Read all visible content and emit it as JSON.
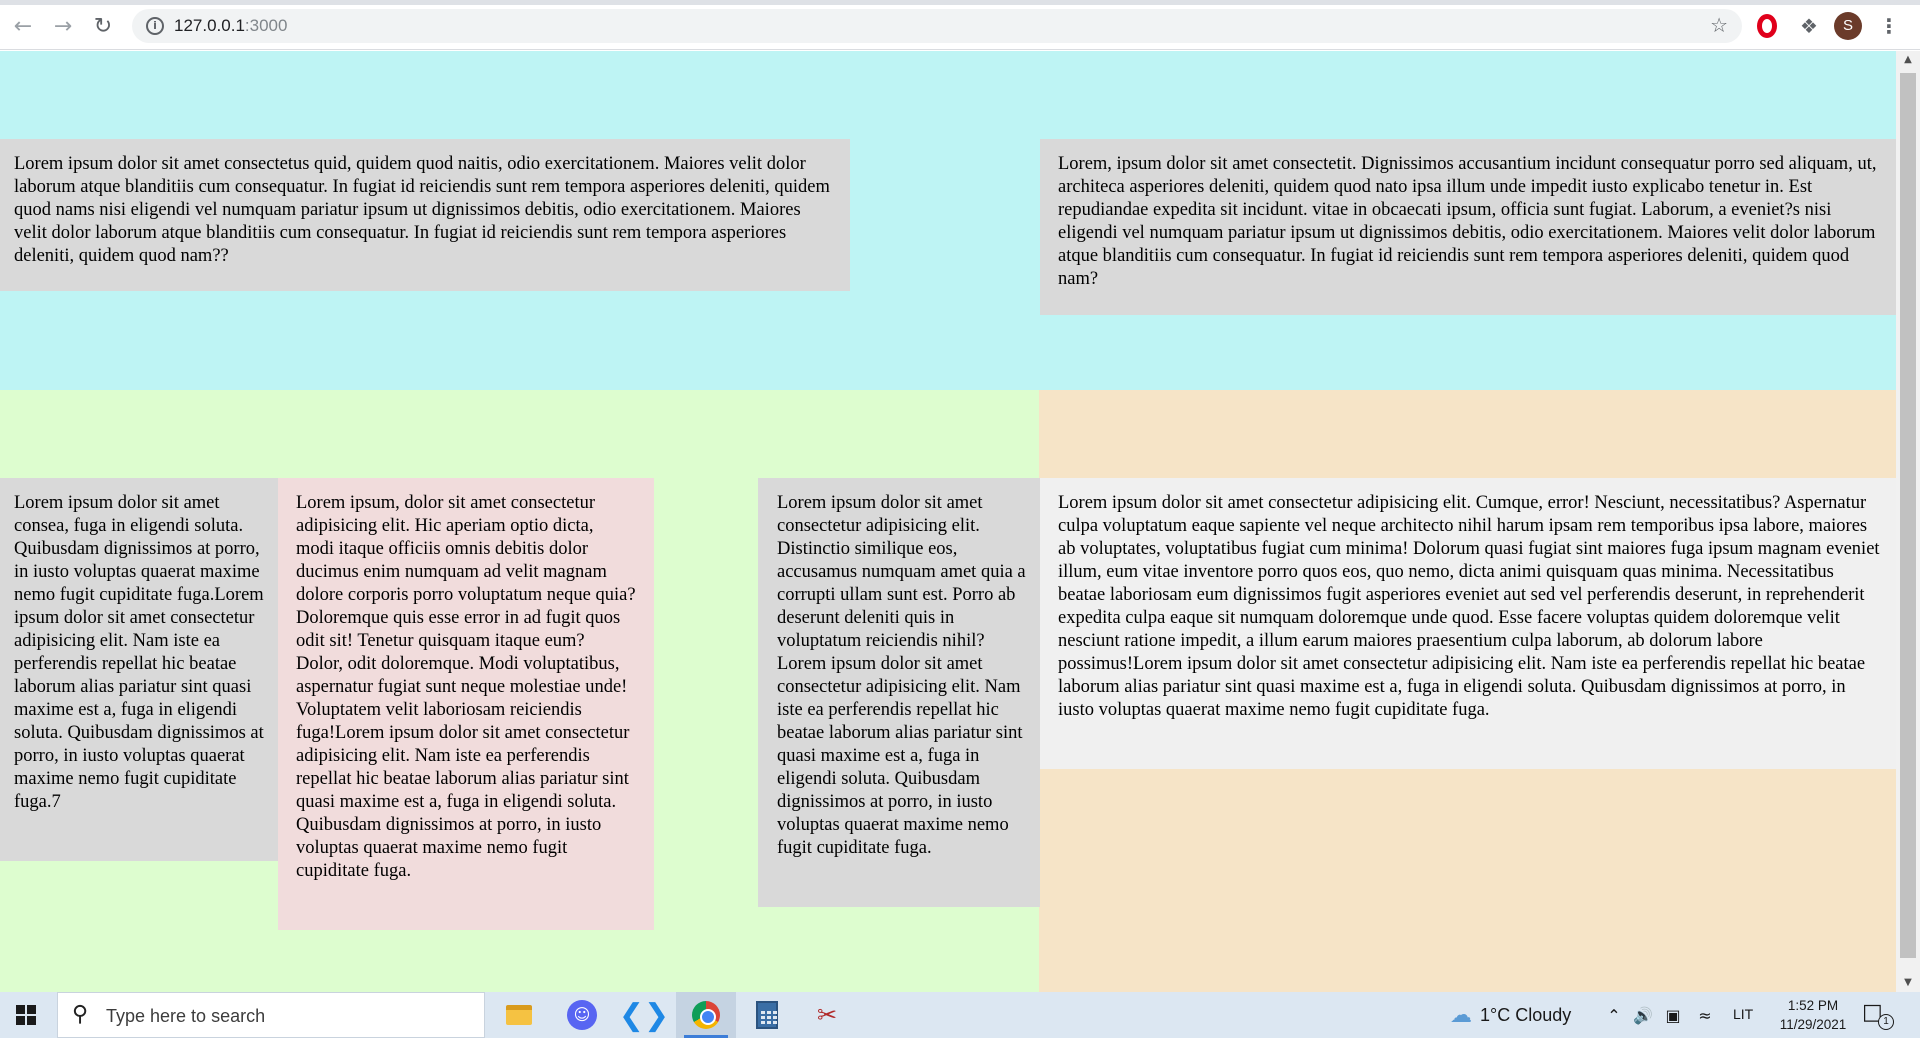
{
  "browser": {
    "url_host": "127.0.0.1",
    "url_port": ":3000",
    "profile_initial": "S",
    "icons": [
      "back-icon",
      "forward-icon",
      "reload-icon",
      "site-info-icon",
      "bookmark-star-icon",
      "opera-adblock-icon",
      "extensions-puzzle-icon",
      "menu-kebab-icon"
    ]
  },
  "colors": {
    "cyan_band": "#bef4f4",
    "green_band": "#ddfdcf",
    "peach_band": "#f6e4c7",
    "gray_box": "#d9d9d9",
    "pink_box": "#f1dcdc",
    "light_box": "#f0f0f0"
  },
  "page": {
    "box_top_left": "Lorem ipsum dolor sit amet consectetus quid, quidem quod naitis, odio exercitationem. Maiores velit dolor laborum atque blanditiis cum consequatur. In fugiat id reiciendis sunt rem tempora asperiores deleniti, quidem quod nams nisi eligendi vel numquam pariatur ipsum ut dignissimos debitis, odio exercitationem. Maiores velit dolor laborum atque blanditiis cum consequatur. In fugiat id reiciendis sunt rem tempora asperiores deleniti, quidem quod nam??",
    "box_top_right": "Lorem, ipsum dolor sit amet consectetit. Dignissimos accusantium incidunt consequatur porro sed aliquam, ut, architeca asperiores deleniti, quidem quod nato ipsa illum unde impedit iusto explicabo tenetur in. Est repudiandae expedita sit incidunt. vitae in obcaecati ipsum, officia sunt fugiat. Laborum, a eveniet?s nisi eligendi vel numquam pariatur ipsum ut dignissimos debitis, odio exercitationem. Maiores velit dolor laborum atque blanditiis cum consequatur. In fugiat id reiciendis sunt rem tempora asperiores deleniti, quidem quod nam?",
    "box_bottom_1": "Lorem ipsum dolor sit amet consea, fuga in eligendi soluta. Quibusdam dignissimos at porro, in iusto voluptas quaerat maxime nemo fugit cupiditate fuga.Lorem ipsum dolor sit amet consectetur adipisicing elit. Nam iste ea perferendis repellat hic beatae laborum alias pariatur sint quasi maxime est a, fuga in eligendi soluta. Quibusdam dignissimos at porro, in iusto voluptas quaerat maxime nemo fugit cupiditate fuga.7",
    "box_bottom_2": "Lorem ipsum, dolor sit amet consectetur adipisicing elit. Hic aperiam optio dicta, modi itaque officiis omnis debitis dolor ducimus enim numquam ad velit magnam dolore corporis porro voluptatum neque quia? Doloremque quis esse error in ad fugit quos odit sit! Tenetur quisquam itaque eum? Dolor, odit doloremque. Modi voluptatibus, aspernatur fugiat sunt neque molestiae unde! Voluptatem velit laboriosam reiciendis fuga!Lorem ipsum dolor sit amet consectetur adipisicing elit. Nam iste ea perferendis repellat hic beatae laborum alias pariatur sint quasi maxime est a, fuga in eligendi soluta. Quibusdam dignissimos at porro, in iusto voluptas quaerat maxime nemo fugit cupiditate fuga.",
    "box_bottom_3": "Lorem ipsum dolor sit amet consectetur adipisicing elit. Distinctio similique eos, accusamus numquam amet quia a corrupti ullam sunt est. Porro ab deserunt deleniti quis in voluptatum reiciendis nihil? Lorem ipsum dolor sit amet consectetur adipisicing elit. Nam iste ea perferendis repellat hic beatae laborum alias pariatur sint quasi maxime est a, fuga in eligendi soluta. Quibusdam dignissimos at porro, in iusto voluptas quaerat maxime nemo fugit cupiditate fuga.",
    "box_bottom_right": "Lorem ipsum dolor sit amet consectetur adipisicing elit. Cumque, error! Nesciunt, necessitatibus? Aspernatur culpa voluptatum eaque sapiente vel neque architecto nihil harum ipsam rem temporibus ipsa labore, maiores ab voluptates, voluptatibus fugiat cum minima! Dolorum quasi fugiat sint maiores fuga ipsum magnam eveniet illum, eum vitae inventore porro quos eos, quo nemo, dicta animi quisquam quas minima. Necessitatibus beatae laboriosam eum dignissimos fugit asperiores eveniet aut sed vel perferendis deserunt, in reprehenderit expedita culpa eaque sit numquam doloremque unde quod. Esse facere voluptas quidem doloremque velit nesciunt ratione impedit, a illum earum maiores praesentium culpa laborum, ab dolorum labore possimus!Lorem ipsum dolor sit amet consectetur adipisicing elit. Nam iste ea perferendis repellat hic beatae laborum alias pariatur sint quasi maxime est a, fuga in eligendi soluta. Quibusdam dignissimos at porro, in iusto voluptas quaerat maxime nemo fugit cupiditate fuga."
  },
  "taskbar": {
    "search_placeholder": "Type here to search",
    "apps": [
      "file-explorer-icon",
      "discord-icon",
      "vscode-icon",
      "chrome-icon",
      "calculator-icon",
      "snipping-tool-icon"
    ],
    "weather": "1°C  Cloudy",
    "language": "LIT",
    "time": "1:52 PM",
    "date": "11/29/2021",
    "notification_count": "1"
  }
}
